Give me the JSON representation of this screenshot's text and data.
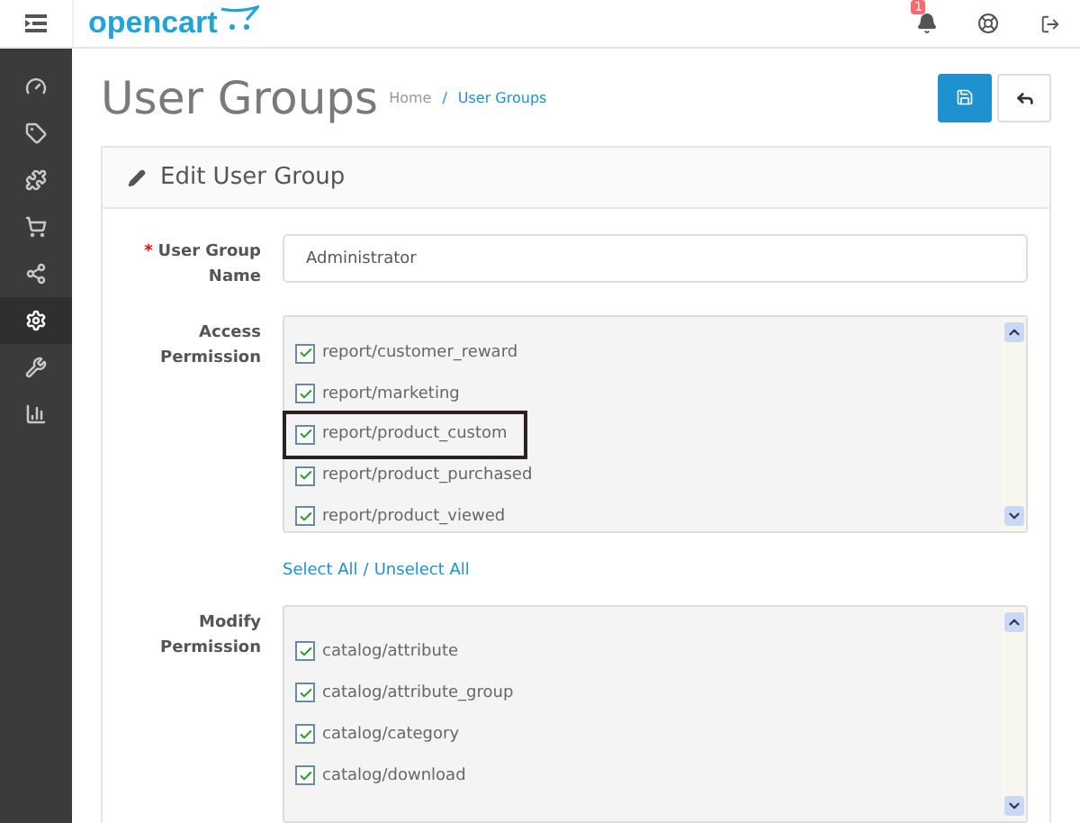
{
  "header": {
    "logo": "opencart",
    "notifications": {
      "badge": "1"
    }
  },
  "sidebar": {
    "items": [
      {
        "selected": false
      },
      {
        "selected": false
      },
      {
        "selected": false
      },
      {
        "selected": false
      },
      {
        "selected": false
      },
      {
        "selected": true
      },
      {
        "selected": false
      },
      {
        "selected": false
      }
    ]
  },
  "page": {
    "title": "User Groups",
    "breadcrumb": [
      "Home",
      "User Groups"
    ],
    "breadcrumb_separator": "/"
  },
  "panel": {
    "title": "Edit User Group",
    "name_field": {
      "label": "User Group Name",
      "required_mark": "*",
      "value": "Administrator"
    },
    "access": {
      "label": "Access Permission",
      "items": [
        {
          "label": "report/customer_reward",
          "checked": true,
          "highlighted": false
        },
        {
          "label": "report/marketing",
          "checked": true,
          "highlighted": false
        },
        {
          "label": "report/product_custom",
          "checked": true,
          "highlighted": true
        },
        {
          "label": "report/product_purchased",
          "checked": true,
          "highlighted": false
        },
        {
          "label": "report/product_viewed",
          "checked": true,
          "highlighted": false
        }
      ]
    },
    "select_all": "Select All",
    "separator": "/",
    "unselect_all": "Unselect All",
    "modify": {
      "label": "Modify Permission",
      "items": [
        {
          "label": "catalog/attribute",
          "checked": true
        },
        {
          "label": "catalog/attribute_group",
          "checked": true
        },
        {
          "label": "catalog/category",
          "checked": true
        },
        {
          "label": "catalog/download",
          "checked": true
        }
      ]
    }
  }
}
